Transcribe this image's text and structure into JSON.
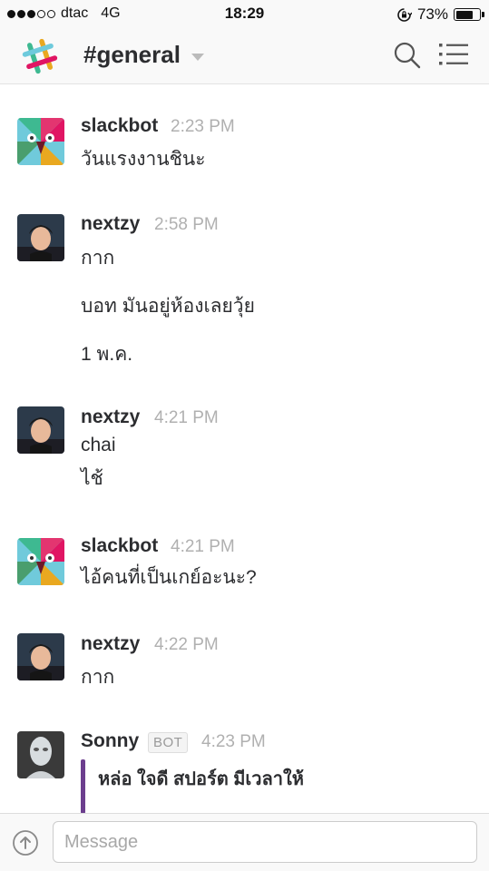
{
  "status_bar": {
    "signal_dots_filled": 3,
    "signal_dots_total": 5,
    "carrier": "dtac",
    "network": "4G",
    "time": "18:29",
    "battery": "73%",
    "battery_level": 0.73,
    "rotation_lock_icon": "rotation-lock-icon"
  },
  "header": {
    "logo_icon": "slack-logo-icon",
    "channel": "#general",
    "dropdown_icon": "chevron-down-icon",
    "search_icon": "search-icon",
    "menu_icon": "menu-list-icon"
  },
  "messages": [
    {
      "author": "slackbot",
      "time": "2:23 PM",
      "lines": [
        "วันแรงงานชินะ"
      ]
    },
    {
      "author": "nextzy",
      "time": "2:58 PM",
      "lines": [
        "กาก",
        "บอท มันอยู่ห้องเลยวุ้ย",
        "1 พ.ค."
      ]
    },
    {
      "author": "nextzy",
      "time": "4:21 PM",
      "lines": [
        "chai",
        "ไช้"
      ]
    },
    {
      "author": "slackbot",
      "time": "4:21 PM",
      "lines": [
        "ไอ้คนที่เป็นเกย์อะนะ?"
      ]
    },
    {
      "author": "nextzy",
      "time": "4:22 PM",
      "lines": [
        "กาก"
      ]
    },
    {
      "author": "Sonny",
      "badge": "BOT",
      "time": "4:23 PM",
      "attachment": "หล่อ ใจดี สปอร์ต มีเวลาให้"
    }
  ],
  "composer": {
    "placeholder": "Message",
    "upload_icon": "upload-arrow-icon"
  }
}
